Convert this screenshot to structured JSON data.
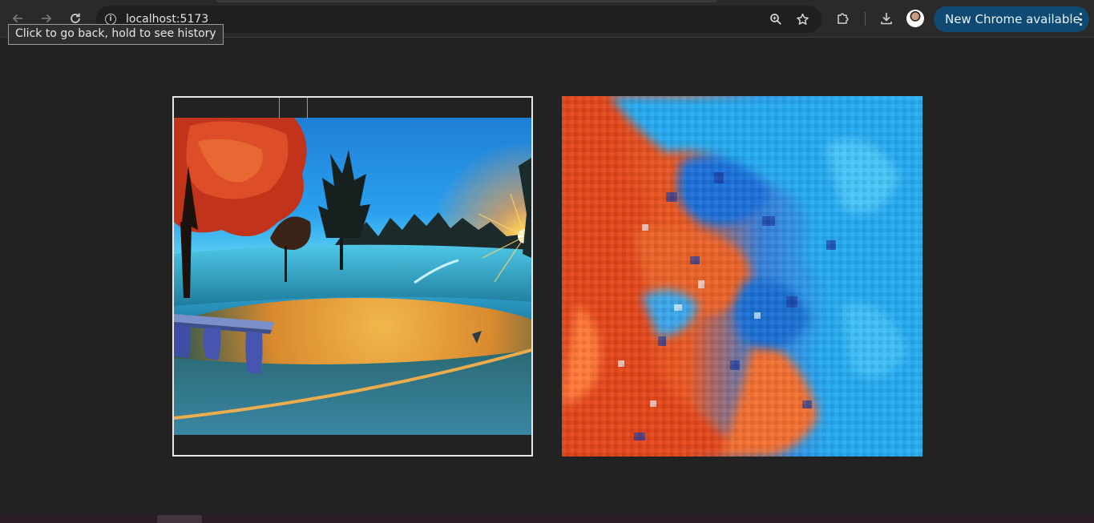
{
  "browser": {
    "url": "localhost:5173",
    "update_button_label": "New Chrome available",
    "tooltip_text": "Click to go back, hold to see history",
    "icons": {
      "back": "arrow-left-icon",
      "forward": "arrow-right-icon",
      "reload": "reload-icon",
      "site_info": "info-icon",
      "zoom": "zoom-icon",
      "bookmark": "star-icon",
      "extensions": "puzzle-icon",
      "downloads": "download-icon",
      "profile": "avatar",
      "menu": "kebab-icon"
    },
    "colors": {
      "update_chip": "#0f4a72",
      "page_background": "#222222"
    }
  },
  "page": {
    "source_image": "park-sunset-with-bench",
    "zoomed_image": "pixelated-magnified-detail"
  }
}
